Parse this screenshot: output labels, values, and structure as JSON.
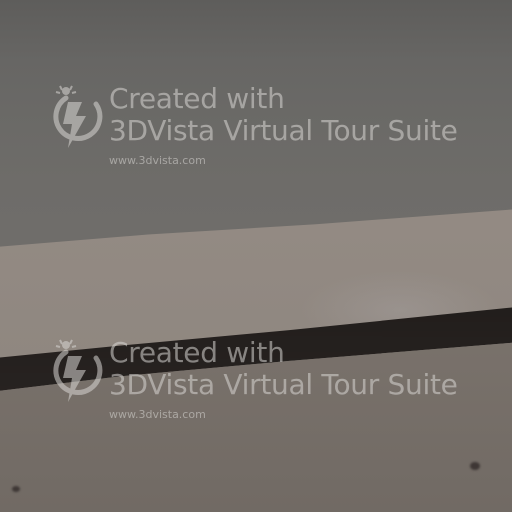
{
  "image": {
    "type": "blurred panorama frame"
  },
  "watermark": {
    "line1": "Created with",
    "line2": "3DVista Virtual Tour Suite",
    "url": "www.3dvista.com",
    "logo_icon": "3dvista-logo-icon",
    "color": "#d8d6d3"
  },
  "colors": {
    "upper_area": "#6b6a67",
    "light_band": "#948a82",
    "dark_stripe": "#221e1c",
    "lower_area": "#7f7770"
  }
}
